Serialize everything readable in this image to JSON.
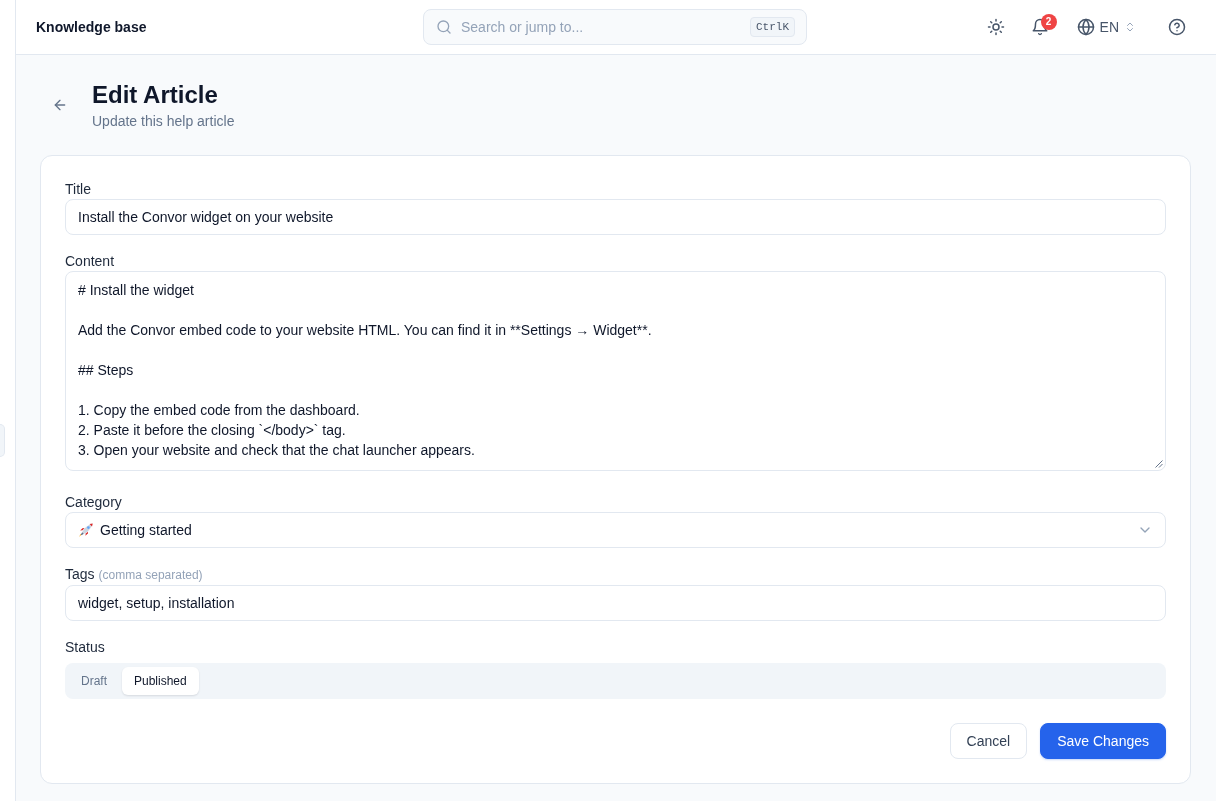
{
  "header": {
    "title": "Knowledge base",
    "search": {
      "placeholder": "Search or jump to...",
      "shortcut": "CtrlK"
    },
    "notifications": {
      "count": "2"
    },
    "language": "EN"
  },
  "page": {
    "title": "Edit Article",
    "subtitle": "Update this help article"
  },
  "form": {
    "fields": [
      {
        "kind": "text",
        "label": "Title",
        "value": "Install the Convor widget on your website"
      },
      {
        "kind": "textarea",
        "label": "Content",
        "value": "# Install the widget\n\nAdd the Convor embed code to your website HTML. You can find it in **Settings → Widget**.\n\n## Steps\n\n1. Copy the embed code from the dashboard.\n2. Paste it before the closing `</body>` tag.\n3. Open your website and check that the chat launcher appears."
      },
      {
        "kind": "select",
        "label": "Category",
        "value": "Getting started"
      },
      {
        "kind": "text",
        "label": "Tags",
        "hint": "(comma separated)",
        "value": "widget, setup, installation"
      },
      {
        "kind": "segmented",
        "label": "Status",
        "options": [
          {
            "label": "Draft",
            "selected": false
          },
          {
            "label": "Published",
            "selected": true
          }
        ]
      }
    ],
    "buttons": [
      {
        "kind": "secondary",
        "label": "Cancel"
      },
      {
        "kind": "primary",
        "label": "Save Changes"
      }
    ]
  }
}
